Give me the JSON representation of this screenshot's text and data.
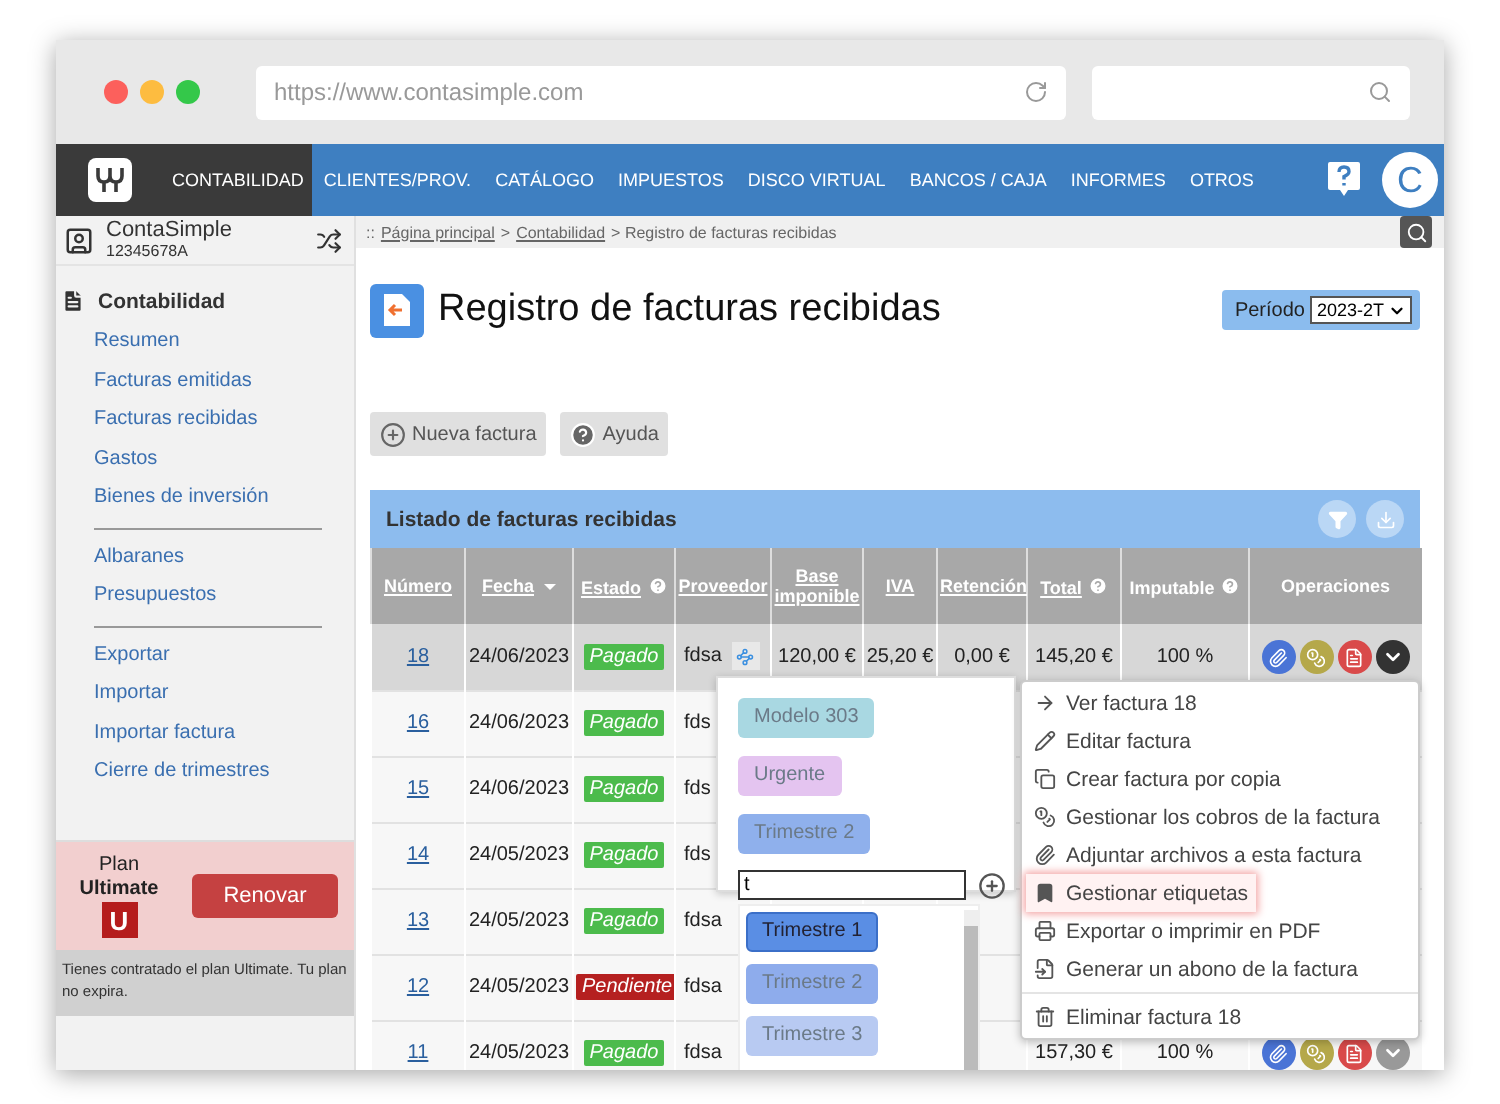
{
  "browser": {
    "url": "https://www.contasimple.com"
  },
  "nav": {
    "items": [
      {
        "label": "CONTABILIDAD",
        "selected": true
      },
      {
        "label": "CLIENTES/PROV.",
        "selected": false
      },
      {
        "label": "CATÁLOGO",
        "selected": false
      },
      {
        "label": "IMPUESTOS",
        "selected": false
      },
      {
        "label": "DISCO VIRTUAL",
        "selected": false
      },
      {
        "label": "BANCOS / CAJA",
        "selected": false
      },
      {
        "label": "INFORMES",
        "selected": false
      },
      {
        "label": "OTROS",
        "selected": false
      }
    ],
    "avatar": "C"
  },
  "account": {
    "name": "ContaSimple",
    "id": "12345678A"
  },
  "sidebar": {
    "section": "Contabilidad",
    "groups": [
      [
        "Resumen",
        "Facturas emitidas",
        "Facturas recibidas",
        "Gastos",
        "Bienes de inversión"
      ],
      [
        "Albaranes",
        "Presupuestos"
      ],
      [
        "Exportar",
        "Importar",
        "Importar factura",
        "Cierre de trimestres"
      ]
    ],
    "plan": {
      "label": "Plan",
      "name": "Ultimate",
      "badge": "U",
      "button": "Renovar",
      "note": "Tienes contratado el plan Ultimate. Tu plan no expira."
    }
  },
  "breadcrumb": [
    {
      "text": "::",
      "kind": "plain"
    },
    {
      "text": "Página principal",
      "kind": "link"
    },
    {
      "text": ">",
      "kind": "plain"
    },
    {
      "text": "Contabilidad",
      "kind": "link"
    },
    {
      "text": "> Registro de facturas recibidas",
      "kind": "plain"
    }
  ],
  "page": {
    "title": "Registro de facturas recibidas",
    "period_label": "Período",
    "period": "2023-2T",
    "buttons": [
      {
        "label": "Nueva factura",
        "kind": "add"
      },
      {
        "label": "Ayuda",
        "kind": "help"
      }
    ]
  },
  "table": {
    "title": "Listado de facturas recibidas",
    "columns": [
      {
        "label": "Número",
        "sortable": true,
        "help": false,
        "sorted": false
      },
      {
        "label": "Fecha",
        "sortable": true,
        "help": false,
        "sorted": true
      },
      {
        "label": "Estado",
        "sortable": true,
        "help": true,
        "sorted": false
      },
      {
        "label": "Proveedor",
        "sortable": true,
        "help": false,
        "sorted": false
      },
      {
        "label": "Base imponible",
        "sortable": true,
        "help": false,
        "sorted": false
      },
      {
        "label": "IVA",
        "sortable": true,
        "help": false,
        "sorted": false
      },
      {
        "label": "Retención",
        "sortable": true,
        "help": false,
        "sorted": false
      },
      {
        "label": "Total",
        "sortable": true,
        "help": true,
        "sorted": false
      },
      {
        "label": "Imputable",
        "sortable": false,
        "help": true,
        "sorted": false
      },
      {
        "label": "Operaciones",
        "sortable": false,
        "help": false,
        "sorted": false
      }
    ],
    "rows": [
      {
        "number": "18",
        "date": "24/06/2023",
        "status": {
          "label": "Pagado",
          "color": "#4cbb4c"
        },
        "supplier": "fdsa",
        "tagged": true,
        "base": "120,00 €",
        "iva": "25,20 €",
        "retencion": "0,00 €",
        "total": "145,20 €",
        "imputable": "100 %",
        "selected": true,
        "menu_open": true
      },
      {
        "number": "16",
        "date": "24/06/2023",
        "status": {
          "label": "Pagado",
          "color": "#4cbb4c"
        },
        "supplier": "fds",
        "selected": false
      },
      {
        "number": "15",
        "date": "24/06/2023",
        "status": {
          "label": "Pagado",
          "color": "#4cbb4c"
        },
        "supplier": "fds",
        "selected": false
      },
      {
        "number": "14",
        "date": "24/05/2023",
        "status": {
          "label": "Pagado",
          "color": "#4cbb4c"
        },
        "supplier": "fds",
        "selected": false
      },
      {
        "number": "13",
        "date": "24/05/2023",
        "status": {
          "label": "Pagado",
          "color": "#4cbb4c"
        },
        "supplier": "fdsa",
        "selected": false
      },
      {
        "number": "12",
        "date": "24/05/2023",
        "status": {
          "label": "Pendiente",
          "color": "#b52020"
        },
        "supplier": "fdsa",
        "selected": false
      },
      {
        "number": "11",
        "date": "24/05/2023",
        "status": {
          "label": "Pagado",
          "color": "#4cbb4c"
        },
        "supplier": "fdsa",
        "total": "157,30 €",
        "imputable": "100 %",
        "selected": false,
        "menu_open": false
      }
    ]
  },
  "tags_popup": {
    "tags": [
      {
        "label": "Modelo 303",
        "color": "#a9d8e2"
      },
      {
        "label": "Urgente",
        "color": "#e4c4f0"
      },
      {
        "label": "Trimestre 2",
        "color": "#8fb0ec"
      }
    ],
    "input_value": "t",
    "suggestions": [
      {
        "label": "Trimestre 1",
        "color": "#5a8ee4",
        "selected": true
      },
      {
        "label": "Trimestre 2",
        "color": "#8eacec",
        "selected": false
      },
      {
        "label": "Trimestre 3",
        "color": "#b8caf2",
        "selected": false
      }
    ]
  },
  "actions_menu": [
    {
      "label": "Ver factura 18",
      "kind": "view",
      "selected": false
    },
    {
      "label": "Editar factura",
      "kind": "edit",
      "selected": false
    },
    {
      "label": "Crear factura por copia",
      "kind": "copy",
      "selected": false
    },
    {
      "label": "Gestionar los cobros de la factura",
      "kind": "payments",
      "selected": false
    },
    {
      "label": "Adjuntar archivos a esta factura",
      "kind": "attach",
      "selected": false
    },
    {
      "label": "Gestionar etiquetas",
      "kind": "tags",
      "selected": true
    },
    {
      "label": "Exportar o imprimir en PDF",
      "kind": "print",
      "selected": false
    },
    {
      "label": "Generar un abono de la factura",
      "kind": "credit",
      "selected": false
    },
    {
      "label": "Eliminar factura 18",
      "kind": "delete",
      "selected": false
    }
  ]
}
